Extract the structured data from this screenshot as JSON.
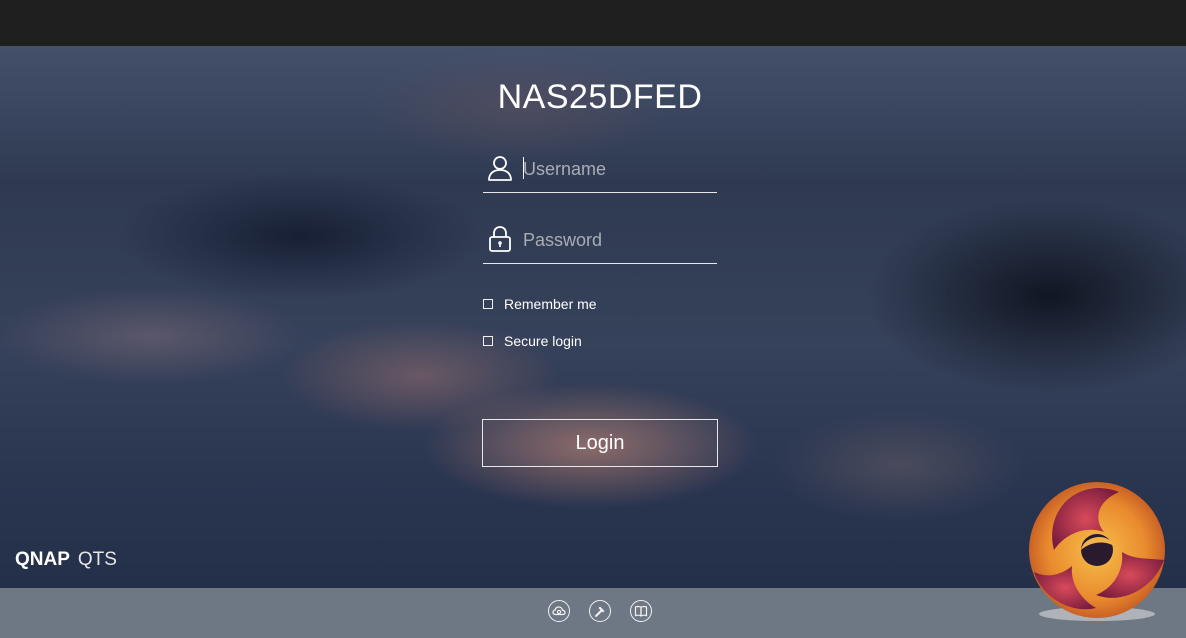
{
  "device_name": "NAS25DFED",
  "login_form": {
    "username_placeholder": "Username",
    "password_placeholder": "Password",
    "remember_me_label": "Remember me",
    "secure_login_label": "Secure login",
    "login_button_label": "Login"
  },
  "brand": {
    "company": "QNAP",
    "product": "QTS"
  },
  "footer_icons": [
    "cloud-icon",
    "tools-icon",
    "book-icon"
  ],
  "colors": {
    "text": "#ffffff",
    "footer_bar": "#6e7784",
    "top_bar": "#1f1f1f"
  }
}
